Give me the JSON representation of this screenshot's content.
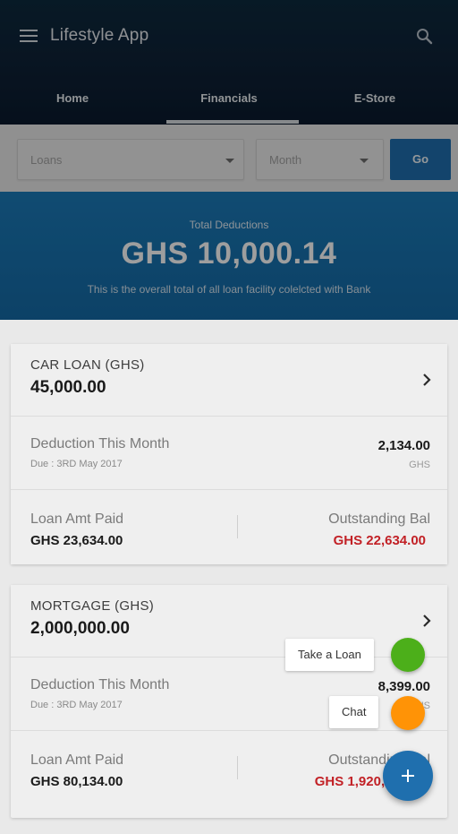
{
  "header": {
    "app_title": "Lifestyle App",
    "tabs": [
      {
        "label": "Home"
      },
      {
        "label": "Financials"
      },
      {
        "label": "E-Store"
      }
    ],
    "active_tab": "Financials"
  },
  "filters": {
    "loan_select_value": "Loans",
    "month_select_value": "Month",
    "go_label": "Go"
  },
  "summary": {
    "label": "Total Deductions",
    "amount": "GHS 10,000.14",
    "description": "This is the overall total of all loan facility colelcted with Bank"
  },
  "loans": [
    {
      "name": "CAR LOAN (GHS)",
      "amount": "45,000.00",
      "deduction_label": "Deduction This Month",
      "due": "Due : 3RD May 2017",
      "deduction_value": "2,134.00",
      "deduction_currency": "GHS",
      "paid_label": "Loan Amt Paid",
      "paid_value": "GHS 23,634.00",
      "outstanding_label": "Outstanding Bal",
      "outstanding_value": "GHS 22,634.00"
    },
    {
      "name": "MORTGAGE (GHS)",
      "amount": "2,000,000.00",
      "deduction_label": "Deduction This Month",
      "due": "Due : 3RD May 2017",
      "deduction_value": "8,399.00",
      "deduction_currency": "GHS",
      "paid_label": "Loan Amt Paid",
      "paid_value": "GHS 80,134.00",
      "outstanding_label": "Outstanding Bal",
      "outstanding_value": "GHS 1,920,134.00"
    }
  ],
  "speed_dial": {
    "take_loan_label": "Take a Loan",
    "chat_label": "Chat"
  },
  "colors": {
    "primary": "#1f6fae",
    "outstanding_red": "#c22126",
    "take_loan_green": "#4caf1a",
    "chat_orange": "#ff9306"
  },
  "icons": {
    "menu": "menu-icon",
    "search": "search-icon",
    "chevron": "chevron-right-icon",
    "dropdown": "caret-down-icon",
    "add": "plus-icon"
  }
}
